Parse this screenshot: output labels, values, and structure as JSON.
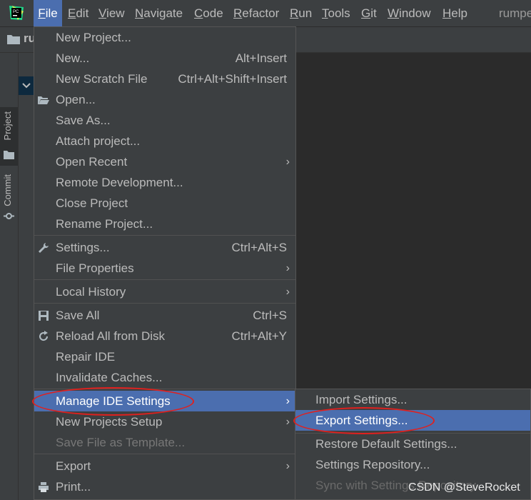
{
  "menubar": {
    "items": [
      {
        "label": "File",
        "underline": "F",
        "rest": "ile"
      },
      {
        "label": "Edit",
        "underline": "E",
        "rest": "dit"
      },
      {
        "label": "View",
        "underline": "V",
        "rest": "iew"
      },
      {
        "label": "Navigate",
        "underline": "N",
        "rest": "avigate"
      },
      {
        "label": "Code",
        "underline": "C",
        "rest": "ode"
      },
      {
        "label": "Refactor",
        "underline": "R",
        "rest": "efactor"
      },
      {
        "label": "Run",
        "underline": "R",
        "rest": "un"
      },
      {
        "label": "Tools",
        "underline": "T",
        "rest": "ools"
      },
      {
        "label": "Git",
        "underline": "G",
        "rest": "it"
      },
      {
        "label": "Window",
        "underline": "W",
        "rest": "indow"
      },
      {
        "label": "Help",
        "underline": "H",
        "rest": "elp"
      }
    ],
    "project_title": "rumpe",
    "logo": "pycharm-logo-icon"
  },
  "navbar": {
    "label": "ru",
    "icon": "folder-icon"
  },
  "toolwindows": {
    "project": "Project",
    "commit": "Commit"
  },
  "file_menu": {
    "new_project": "New Project...",
    "new": "New...",
    "new_shortcut": "Alt+Insert",
    "new_scratch": "New Scratch File",
    "new_scratch_shortcut": "Ctrl+Alt+Shift+Insert",
    "open": "Open...",
    "save_as": "Save As...",
    "attach_project": "Attach project...",
    "open_recent": "Open Recent",
    "remote_dev": "Remote Development...",
    "close_project": "Close Project",
    "rename_project": "Rename Project...",
    "settings": "Settings...",
    "settings_shortcut": "Ctrl+Alt+S",
    "file_properties": "File Properties",
    "local_history": "Local History",
    "save_all": "Save All",
    "save_all_shortcut": "Ctrl+S",
    "reload": "Reload All from Disk",
    "reload_shortcut": "Ctrl+Alt+Y",
    "repair_ide": "Repair IDE",
    "invalidate": "Invalidate Caches...",
    "manage_ide": "Manage IDE Settings",
    "new_projects_setup": "New Projects Setup",
    "save_template": "Save File as Template...",
    "export": "Export",
    "print": "Print..."
  },
  "submenu": {
    "import": "Import Settings...",
    "export": "Export Settings...",
    "restore": "Restore Default Settings...",
    "repository": "Settings Repository...",
    "sync": "Sync with Settings Repository"
  },
  "colors": {
    "accent": "#4b6eaf",
    "annotation": "#e0201e"
  },
  "watermark": "CSDN @SteveRocket"
}
